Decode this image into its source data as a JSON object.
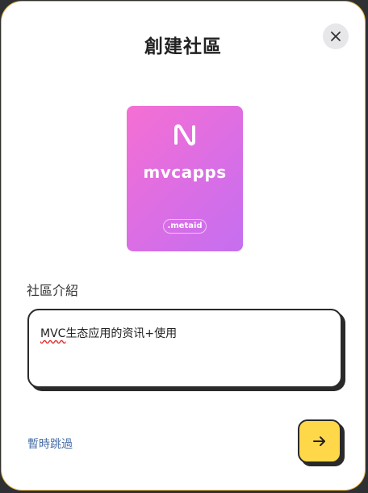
{
  "dialog": {
    "title": "創建社區",
    "close_icon": "close-icon"
  },
  "cover": {
    "logo_icon": "mvc-logo-icon",
    "name": "mvcapps",
    "tag": ".metaid",
    "gradient_start": "#f56fd3",
    "gradient_end": "#c56ff0"
  },
  "intro": {
    "label": "社區介紹",
    "value_prefix": "MVC",
    "value_rest": "生态应用的资讯+使用"
  },
  "footer": {
    "skip_label": "暫時跳過",
    "next_icon": "arrow-right-icon",
    "next_color": "#ffd84a"
  }
}
